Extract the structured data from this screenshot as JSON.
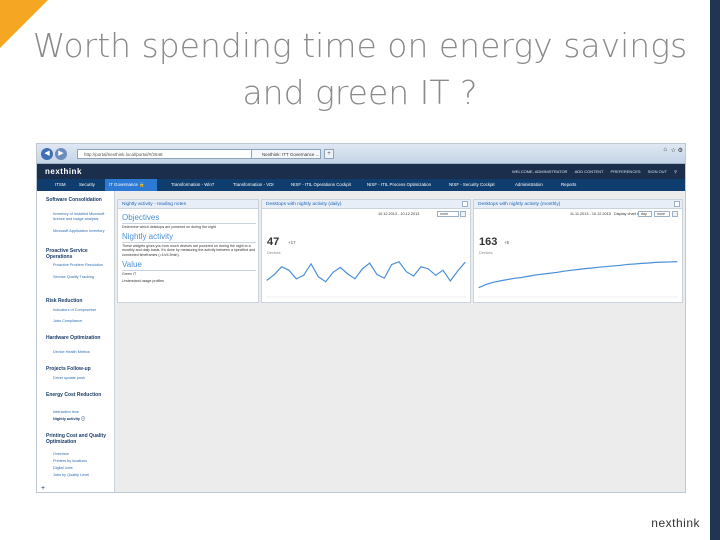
{
  "slide": {
    "title_line1": "Worth spending time on energy savings",
    "title_line2": "and green IT ?",
    "footer_logo": "nexthink",
    "accent_color": "#f5a623",
    "edge_color": "#1f3550"
  },
  "browser": {
    "address": "http://portal/nexthink.local/portal/#/2648",
    "tab_label": "Nexthink: ITT Governance ...",
    "back_icon": "back-arrow-icon",
    "forward_icon": "forward-arrow-icon"
  },
  "app": {
    "logo": "nexthink",
    "user_links": [
      "WELCOME, ADMINISTRATOR",
      "ADD CONTENT",
      "PREFERENCES",
      "SIGN OUT"
    ],
    "nav_tabs": [
      {
        "label": "ITSM"
      },
      {
        "label": "Security"
      },
      {
        "label": "IT Governance"
      },
      {
        "label": "Transformation - Win7"
      },
      {
        "label": "Transformation - VDI"
      },
      {
        "label": "NISF - ITIL Operations Cockpit"
      },
      {
        "label": "NISF - ITIL Process Optimization"
      },
      {
        "label": "NISF - Security Cockpit"
      },
      {
        "label": "Administration"
      },
      {
        "label": "Reports"
      }
    ],
    "active_tab": "IT Governance"
  },
  "sidebar": {
    "groups": [
      {
        "title": "Software Consolidation",
        "items": [
          "Inventory of Installed Microsoft licence and usage analysis",
          "Microsoft Application Inventory"
        ]
      },
      {
        "title": "Proactive Service Operations",
        "items": [
          "Proactive Problem Resolution",
          "Service Quality Tracking"
        ]
      },
      {
        "title": "Risk Reduction",
        "items": [
          "Indicators of Compromise",
          "Jobs Compliance"
        ]
      },
      {
        "title": "Hardware Optimization",
        "items": [
          "Device Health Metrics"
        ]
      },
      {
        "title": "Projects Follow-up",
        "items": [
          "Driver update push"
        ]
      },
      {
        "title": "Energy Cost Reduction",
        "items": [
          "Interaction time",
          "Nightly activity"
        ]
      },
      {
        "title": "Printing Cost and Quality Optimization",
        "items": [
          "Overview",
          "Printers by locations",
          "Digital Jobs",
          "Jobs by Quality Level"
        ]
      }
    ],
    "active_item": "Nightly activity",
    "add_label": "+"
  },
  "panels": {
    "notes": {
      "title": "Nightly activity - reading notes",
      "objectives_heading": "Objectives",
      "objectives_text": "Determine which desktops are powered on during the night",
      "subheading": "Nightly activity",
      "body": "These widgets gives you how much devices are powered on during the night to a monthly and daily basis. It's done by measuring the activity between a specified and connected timeframes (>1h/4.5min).",
      "value_heading": "Value",
      "value_items": [
        "Green IT",
        "Understand usage profiles"
      ]
    },
    "daily": {
      "title": "Desktops with nightly activity (daily)",
      "date_range": "10.12.2013 - 10.12.2013",
      "filter": "none",
      "kpi": "47",
      "delta": "+17",
      "kpi_label": "Devices"
    },
    "monthly": {
      "title": "Desktops with nightly activity (monthly)",
      "date_range": "11.11.2013 - 10.12.2013",
      "display_label": "Display chart by",
      "display_value": "day",
      "filter": "none",
      "kpi": "163",
      "delta": "+5",
      "kpi_label": "Devices"
    }
  },
  "chart_data": [
    {
      "type": "line",
      "title": "Desktops with nightly activity (daily)",
      "values": [
        22,
        30,
        41,
        36,
        24,
        29,
        45,
        27,
        20,
        33,
        40,
        31,
        24,
        38,
        46,
        30,
        25,
        44,
        48,
        34,
        28,
        41,
        38,
        29,
        36,
        21,
        35,
        47
      ],
      "color": "#4a90d9"
    },
    {
      "type": "line",
      "title": "Desktops with nightly activity (monthly)",
      "values": [
        40,
        55,
        65,
        72,
        78,
        84,
        88,
        94,
        100,
        104,
        108,
        112,
        118,
        122,
        126,
        130,
        133,
        137,
        140,
        143,
        146,
        150,
        152,
        155,
        157,
        160,
        161,
        162,
        163
      ],
      "color": "#4a90d9"
    }
  ]
}
